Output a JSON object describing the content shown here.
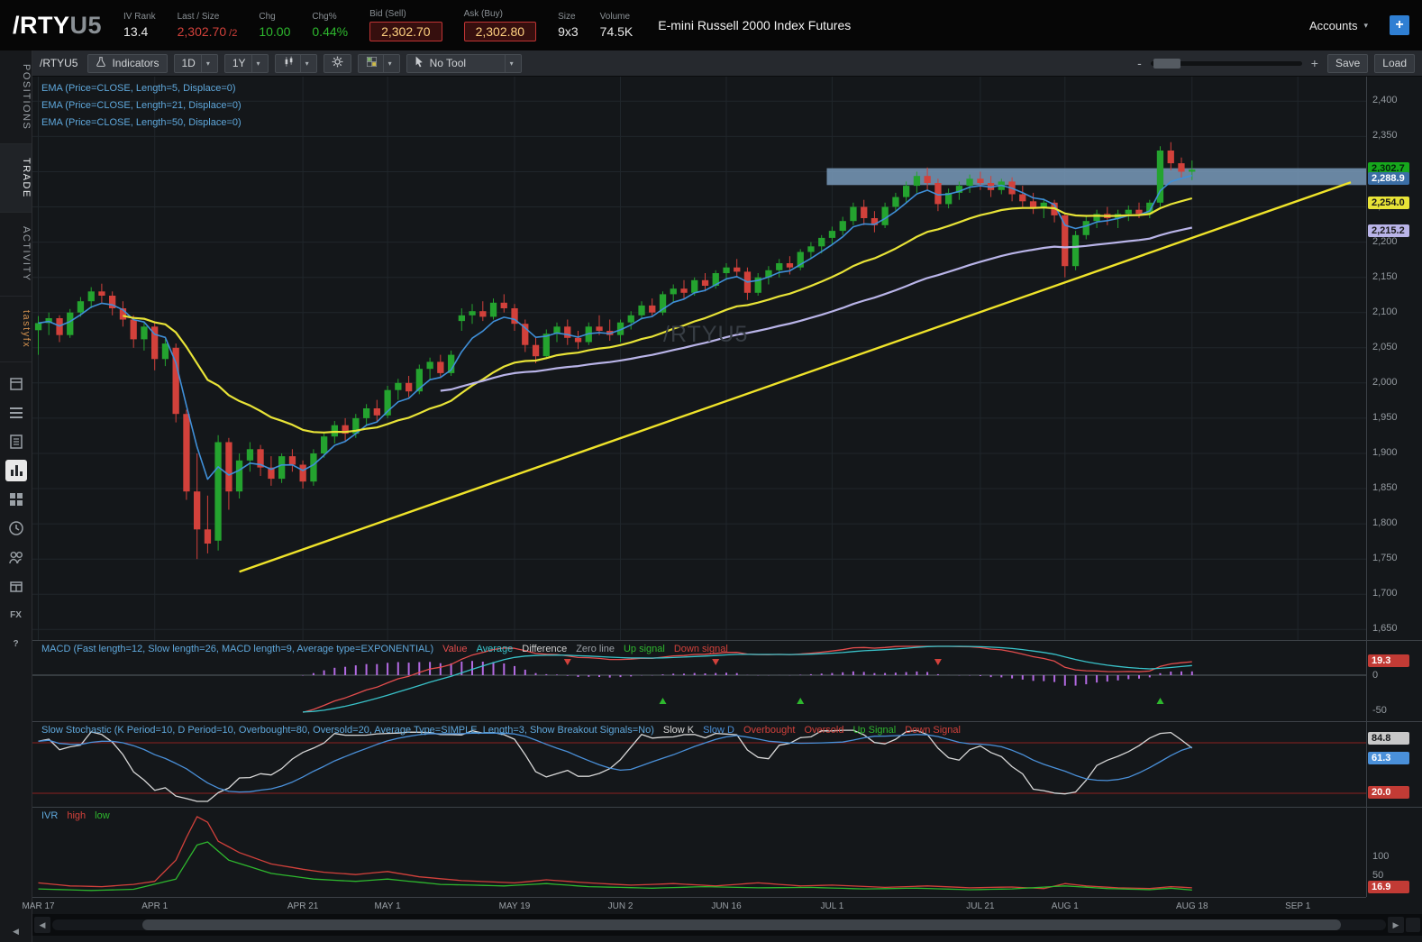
{
  "header": {
    "symbol": "/RTY",
    "symbol_suffix": "U5",
    "iv_rank": {
      "label": "IV Rank",
      "value": "13.4"
    },
    "last_size": {
      "label": "Last / Size",
      "value": "2,302.70",
      "suffix": " /2"
    },
    "chg": {
      "label": "Chg",
      "value": "10.00"
    },
    "chg_pct": {
      "label": "Chg%",
      "value": "0.44%"
    },
    "bid": {
      "label": "Bid (Sell)",
      "value": "2,302.70"
    },
    "ask": {
      "label": "Ask (Buy)",
      "value": "2,302.80"
    },
    "size": {
      "label": "Size",
      "value": "9x3"
    },
    "volume": {
      "label": "Volume",
      "value": "74.5K"
    },
    "description": "E-mini Russell 2000 Index Futures",
    "accounts_label": "Accounts",
    "add_button": "+"
  },
  "sidebar": {
    "tabs": [
      {
        "label": "POSITIONS",
        "active": false
      },
      {
        "label": "TRADE",
        "active": true
      },
      {
        "label": "ACTIVITY",
        "active": false
      },
      {
        "label": "tastyfx",
        "active": false,
        "accent": true
      }
    ],
    "icons": [
      {
        "name": "watchlist-icon",
        "icon": "cal"
      },
      {
        "name": "orders-icon",
        "icon": "list"
      },
      {
        "name": "positions-doc-icon",
        "icon": "doc"
      },
      {
        "name": "chart-icon",
        "icon": "chart",
        "active": true
      },
      {
        "name": "dashboard-grid-icon",
        "icon": "grid"
      },
      {
        "name": "history-clock-icon",
        "icon": "clock"
      },
      {
        "name": "community-people-icon",
        "icon": "people"
      },
      {
        "name": "products-box-icon",
        "icon": "box"
      },
      {
        "name": "fx-icon",
        "text": "FX"
      },
      {
        "name": "help-icon",
        "text": "?"
      }
    ],
    "collapse_arrow": "◀"
  },
  "toolbar": {
    "symbol": "/RTYU5",
    "indicators_label": "Indicators",
    "timeframe": "1D",
    "range": "1Y",
    "tool_label": "No Tool",
    "zoom_out": "-",
    "zoom_in": "+",
    "save_label": "Save",
    "load_label": "Load"
  },
  "scrollbar": {
    "left_arrow": "◀",
    "right_arrow": "▶"
  },
  "chart_data": {
    "type": "candlestick",
    "symbol": "/RTYU5",
    "watermark": "/RTYU5",
    "colors": {
      "up": "#24a32f",
      "down": "#d2413b",
      "ema5": "#3f8fd8",
      "ema21": "#e8e337",
      "ema50": "#b9b4e8",
      "band": "#7596b5",
      "trendline": "#efe32a",
      "grid": "#20262b",
      "macd_value": "#e34d4d",
      "macd_average": "#39c2c9",
      "macd_hist": "#b36ae2",
      "stoch_k": "#d8d8d8",
      "stoch_d": "#4a90d9",
      "stoch_band": "#8b2020",
      "ivr_high": "#d2413b",
      "ivr_low": "#2eb82e"
    },
    "price_axis": {
      "min": 1635,
      "max": 2435,
      "tick_step": 50,
      "ticks": [
        2400,
        2350,
        2300,
        2250,
        2200,
        2150,
        2100,
        2050,
        2000,
        1950,
        1900,
        1850,
        1800,
        1750,
        1700,
        1650
      ]
    },
    "time_axis": {
      "total_slots": 126,
      "labels": [
        {
          "text": "MAR 17",
          "index": 0
        },
        {
          "text": "APR 1",
          "index": 11
        },
        {
          "text": "APR 21",
          "index": 25
        },
        {
          "text": "MAY 1",
          "index": 33
        },
        {
          "text": "MAY 19",
          "index": 45
        },
        {
          "text": "JUN 2",
          "index": 55
        },
        {
          "text": "JUN 16",
          "index": 65
        },
        {
          "text": "JUL 1",
          "index": 75
        },
        {
          "text": "JUL 21",
          "index": 89
        },
        {
          "text": "AUG 1",
          "index": 97
        },
        {
          "text": "AUG 18",
          "index": 109
        },
        {
          "text": "SEP 1",
          "index": 119
        }
      ]
    },
    "candles": [
      [
        2075,
        2095,
        2040,
        2085
      ],
      [
        2085,
        2100,
        2068,
        2092
      ],
      [
        2092,
        2096,
        2058,
        2068
      ],
      [
        2068,
        2105,
        2064,
        2100
      ],
      [
        2100,
        2122,
        2094,
        2116
      ],
      [
        2116,
        2136,
        2106,
        2130
      ],
      [
        2130,
        2141,
        2114,
        2124
      ],
      [
        2124,
        2130,
        2096,
        2106
      ],
      [
        2106,
        2116,
        2080,
        2090
      ],
      [
        2090,
        2096,
        2050,
        2062
      ],
      [
        2062,
        2086,
        2046,
        2080
      ],
      [
        2080,
        2086,
        2018,
        2034
      ],
      [
        2034,
        2062,
        2024,
        2056
      ],
      [
        2050,
        2056,
        1944,
        1956
      ],
      [
        1956,
        1962,
        1834,
        1846
      ],
      [
        1846,
        1900,
        1750,
        1792
      ],
      [
        1792,
        1840,
        1758,
        1772
      ],
      [
        1776,
        1926,
        1762,
        1916
      ],
      [
        1916,
        1922,
        1820,
        1846
      ],
      [
        1846,
        1900,
        1836,
        1890
      ],
      [
        1890,
        1916,
        1874,
        1906
      ],
      [
        1906,
        1912,
        1868,
        1880
      ],
      [
        1880,
        1896,
        1854,
        1864
      ],
      [
        1864,
        1900,
        1858,
        1896
      ],
      [
        1896,
        1906,
        1874,
        1884
      ],
      [
        1884,
        1890,
        1850,
        1860
      ],
      [
        1860,
        1906,
        1854,
        1900
      ],
      [
        1900,
        1930,
        1894,
        1924
      ],
      [
        1924,
        1946,
        1914,
        1940
      ],
      [
        1940,
        1950,
        1918,
        1928
      ],
      [
        1928,
        1956,
        1922,
        1950
      ],
      [
        1950,
        1970,
        1940,
        1964
      ],
      [
        1964,
        1976,
        1944,
        1954
      ],
      [
        1954,
        1996,
        1950,
        1990
      ],
      [
        1990,
        2006,
        1976,
        2000
      ],
      [
        2000,
        2010,
        1980,
        1988
      ],
      [
        1988,
        2026,
        1984,
        2020
      ],
      [
        2020,
        2036,
        2004,
        2030
      ],
      [
        2030,
        2040,
        2008,
        2014
      ],
      [
        2014,
        2046,
        2010,
        2040
      ],
      [
        2088,
        2106,
        2074,
        2096
      ],
      [
        2096,
        2112,
        2084,
        2102
      ],
      [
        2102,
        2116,
        2088,
        2094
      ],
      [
        2094,
        2120,
        2090,
        2114
      ],
      [
        2114,
        2126,
        2100,
        2106
      ],
      [
        2106,
        2112,
        2074,
        2084
      ],
      [
        2084,
        2090,
        2044,
        2054
      ],
      [
        2054,
        2064,
        2028,
        2038
      ],
      [
        2038,
        2076,
        2034,
        2070
      ],
      [
        2070,
        2086,
        2058,
        2080
      ],
      [
        2080,
        2090,
        2054,
        2064
      ],
      [
        2064,
        2074,
        2048,
        2058
      ],
      [
        2058,
        2086,
        2054,
        2080
      ],
      [
        2080,
        2096,
        2068,
        2074
      ],
      [
        2074,
        2090,
        2060,
        2068
      ],
      [
        2068,
        2090,
        2058,
        2086
      ],
      [
        2086,
        2102,
        2076,
        2096
      ],
      [
        2096,
        2116,
        2090,
        2110
      ],
      [
        2110,
        2120,
        2094,
        2100
      ],
      [
        2100,
        2130,
        2096,
        2126
      ],
      [
        2126,
        2140,
        2114,
        2134
      ],
      [
        2134,
        2146,
        2120,
        2128
      ],
      [
        2128,
        2150,
        2124,
        2146
      ],
      [
        2146,
        2156,
        2130,
        2138
      ],
      [
        2138,
        2160,
        2134,
        2156
      ],
      [
        2156,
        2170,
        2146,
        2164
      ],
      [
        2164,
        2176,
        2150,
        2158
      ],
      [
        2158,
        2164,
        2118,
        2128
      ],
      [
        2128,
        2156,
        2124,
        2150
      ],
      [
        2150,
        2166,
        2140,
        2160
      ],
      [
        2160,
        2176,
        2150,
        2170
      ],
      [
        2170,
        2180,
        2154,
        2164
      ],
      [
        2164,
        2190,
        2160,
        2186
      ],
      [
        2186,
        2200,
        2176,
        2194
      ],
      [
        2194,
        2210,
        2184,
        2206
      ],
      [
        2206,
        2222,
        2196,
        2216
      ],
      [
        2216,
        2236,
        2210,
        2230
      ],
      [
        2230,
        2256,
        2224,
        2250
      ],
      [
        2250,
        2260,
        2224,
        2234
      ],
      [
        2234,
        2244,
        2214,
        2224
      ],
      [
        2224,
        2256,
        2220,
        2250
      ],
      [
        2250,
        2270,
        2244,
        2264
      ],
      [
        2264,
        2286,
        2256,
        2280
      ],
      [
        2280,
        2300,
        2270,
        2294
      ],
      [
        2294,
        2306,
        2274,
        2284
      ],
      [
        2284,
        2290,
        2244,
        2254
      ],
      [
        2254,
        2276,
        2248,
        2270
      ],
      [
        2270,
        2286,
        2260,
        2280
      ],
      [
        2280,
        2296,
        2270,
        2290
      ],
      [
        2290,
        2300,
        2274,
        2284
      ],
      [
        2284,
        2294,
        2264,
        2274
      ],
      [
        2274,
        2290,
        2268,
        2286
      ],
      [
        2286,
        2292,
        2258,
        2268
      ],
      [
        2268,
        2280,
        2250,
        2258
      ],
      [
        2258,
        2270,
        2240,
        2248
      ],
      [
        2248,
        2262,
        2234,
        2256
      ],
      [
        2256,
        2260,
        2228,
        2238
      ],
      [
        2238,
        2242,
        2150,
        2166
      ],
      [
        2166,
        2216,
        2160,
        2210
      ],
      [
        2210,
        2236,
        2204,
        2230
      ],
      [
        2230,
        2246,
        2220,
        2240
      ],
      [
        2240,
        2250,
        2224,
        2234
      ],
      [
        2234,
        2246,
        2220,
        2240
      ],
      [
        2240,
        2252,
        2230,
        2246
      ],
      [
        2246,
        2256,
        2234,
        2240
      ],
      [
        2240,
        2260,
        2234,
        2256
      ],
      [
        2256,
        2336,
        2250,
        2330
      ],
      [
        2330,
        2342,
        2302,
        2312
      ],
      [
        2312,
        2320,
        2290,
        2300
      ],
      [
        2300,
        2316,
        2288,
        2303
      ]
    ],
    "ema_studies": [
      {
        "label": "EMA (Price=CLOSE, Length=5, Displace=0)",
        "length": 5,
        "color_key": "ema5",
        "badge": "2,288.9",
        "badge_bg": "#3b6ea5",
        "badge_fg": "#ffffff",
        "draw_from": 0
      },
      {
        "label": "EMA (Price=CLOSE, Length=21, Displace=0)",
        "length": 21,
        "color_key": "ema21",
        "badge": "2,254.0",
        "badge_bg": "#e8e337",
        "badge_fg": "#1a1a1a",
        "draw_from": 8
      },
      {
        "label": "EMA (Price=CLOSE, Length=50, Displace=0)",
        "length": 50,
        "color_key": "ema50",
        "badge": "2,215.2",
        "badge_bg": "#b9b4e8",
        "badge_fg": "#1a1a1a",
        "draw_from": 38
      }
    ],
    "last_price_badge": "2,302.7",
    "drawings": {
      "band": {
        "start_index": 75,
        "price_top": 2305,
        "price_bottom": 2281
      },
      "trendline": {
        "from_index": 19,
        "from_price": 1732,
        "to_index": 124,
        "to_price": 2285
      }
    },
    "macd": {
      "title": "MACD (Fast length=12, Slow length=26, MACD length=9, Average type=EXPONENTIAL)",
      "legend": [
        {
          "text": "Value",
          "color": "#e34d4d"
        },
        {
          "text": "Average",
          "color": "#39c2c9"
        },
        {
          "text": "Difference",
          "color": "#cfcfcf"
        },
        {
          "text": "Zero line",
          "color": "#9aa0a6"
        },
        {
          "text": "Up signal",
          "color": "#2eb82e"
        },
        {
          "text": "Down signal",
          "color": "#d2413b"
        }
      ],
      "params": {
        "fast": 12,
        "slow": 26,
        "signal": 9
      },
      "up_signal_indices": [
        59,
        72,
        106
      ],
      "down_signal_indices": [
        50,
        64,
        85
      ],
      "axis_labels": [
        {
          "text": "0",
          "value": 0
        },
        {
          "text": "-50",
          "value": -50
        }
      ],
      "badge": "19.3"
    },
    "stochastic": {
      "title": "Slow Stochastic (K Period=10, D Period=10, Overbought=80, Oversold=20, Average Type=SIMPLE, Length=3, Show Breakout Signals=No)",
      "legend": [
        {
          "text": "Slow K",
          "color": "#d8d8d8"
        },
        {
          "text": "Slow D",
          "color": "#4a90d9"
        },
        {
          "text": "Overbought",
          "color": "#d2413b"
        },
        {
          "text": "Oversold",
          "color": "#d2413b"
        },
        {
          "text": "Up Signal",
          "color": "#2eb82e"
        },
        {
          "text": "Down Signal",
          "color": "#d2413b"
        }
      ],
      "overbought": 80,
      "oversold": 20,
      "badges": [
        {
          "value": "84.8",
          "bg": "#c8c8c8",
          "fg": "#16181a"
        },
        {
          "value": "61.3",
          "bg": "#4a90d9",
          "fg": "#ffffff"
        },
        {
          "value": "20.0",
          "bg": "#c23b35",
          "fg": "#ffffff"
        }
      ]
    },
    "ivr": {
      "title": "IVR",
      "legend": [
        {
          "text": "high",
          "color": "#d2413b"
        },
        {
          "text": "low",
          "color": "#2eb82e"
        }
      ],
      "axis_labels": [
        {
          "text": "100",
          "value": 100
        },
        {
          "text": "50",
          "value": 50
        }
      ],
      "badge": "16.9",
      "high_points": [
        [
          0,
          30
        ],
        [
          3,
          22
        ],
        [
          6,
          20
        ],
        [
          9,
          26
        ],
        [
          11,
          34
        ],
        [
          13,
          90
        ],
        [
          14,
          150
        ],
        [
          15,
          205
        ],
        [
          16,
          190
        ],
        [
          17,
          140
        ],
        [
          19,
          110
        ],
        [
          22,
          80
        ],
        [
          25,
          66
        ],
        [
          27,
          58
        ],
        [
          30,
          52
        ],
        [
          33,
          60
        ],
        [
          36,
          46
        ],
        [
          40,
          36
        ],
        [
          45,
          30
        ],
        [
          48,
          38
        ],
        [
          52,
          30
        ],
        [
          56,
          24
        ],
        [
          60,
          28
        ],
        [
          64,
          22
        ],
        [
          68,
          30
        ],
        [
          72,
          22
        ],
        [
          75,
          24
        ],
        [
          80,
          18
        ],
        [
          84,
          22
        ],
        [
          88,
          17
        ],
        [
          92,
          19
        ],
        [
          95,
          15
        ],
        [
          97,
          28
        ],
        [
          99,
          22
        ],
        [
          102,
          17
        ],
        [
          105,
          15
        ],
        [
          107,
          20
        ],
        [
          109,
          17
        ]
      ],
      "low_points": [
        [
          0,
          14
        ],
        [
          5,
          10
        ],
        [
          9,
          13
        ],
        [
          13,
          40
        ],
        [
          15,
          130
        ],
        [
          16,
          138
        ],
        [
          18,
          90
        ],
        [
          22,
          55
        ],
        [
          26,
          40
        ],
        [
          30,
          34
        ],
        [
          33,
          40
        ],
        [
          38,
          26
        ],
        [
          44,
          22
        ],
        [
          48,
          28
        ],
        [
          52,
          20
        ],
        [
          58,
          16
        ],
        [
          63,
          20
        ],
        [
          68,
          17
        ],
        [
          73,
          18
        ],
        [
          78,
          14
        ],
        [
          83,
          16
        ],
        [
          88,
          12
        ],
        [
          92,
          14
        ],
        [
          97,
          22
        ],
        [
          101,
          15
        ],
        [
          105,
          12
        ],
        [
          107,
          16
        ],
        [
          109,
          11
        ]
      ]
    }
  },
  "ui_colors": {
    "positive": "#2eb82e",
    "negative": "#d2413b",
    "accent_blue": "#2f7fd3"
  }
}
